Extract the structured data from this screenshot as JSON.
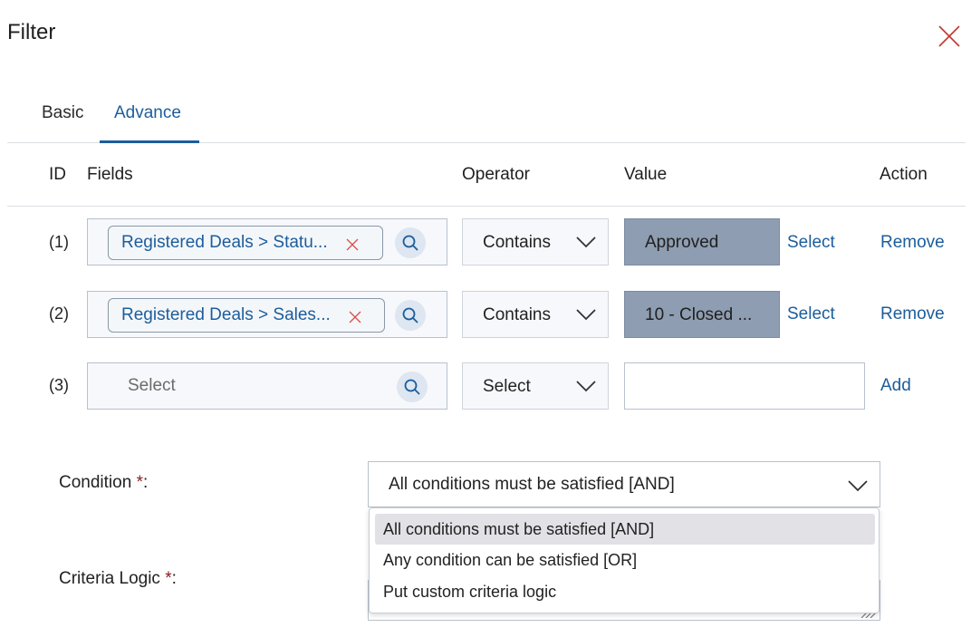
{
  "dialog": {
    "title": "Filter",
    "close_icon": "close-icon"
  },
  "tabs": [
    {
      "label": "Basic",
      "active": false
    },
    {
      "label": "Advance",
      "active": true
    }
  ],
  "columns": {
    "id": "ID",
    "fields": "Fields",
    "operator": "Operator",
    "value": "Value",
    "action": "Action"
  },
  "rows": [
    {
      "id": "(1)",
      "field": "Registered Deals > Statu...",
      "operator": "Contains",
      "value": "Approved",
      "select_label": "Select",
      "action": "Remove"
    },
    {
      "id": "(2)",
      "field": "Registered Deals > Sales...",
      "operator": "Contains",
      "value": "10 - Closed ...",
      "select_label": "Select",
      "action": "Remove"
    },
    {
      "id": "(3)",
      "field_placeholder": "Select",
      "operator": "Select",
      "value": "",
      "action": "Add"
    }
  ],
  "condition": {
    "label": "Condition",
    "required_mark": "*",
    "colon": ":",
    "selected": "All conditions must be satisfied [AND]",
    "options": [
      "All conditions must be satisfied [AND]",
      "Any condition can be satisfied [OR]",
      "Put custom criteria logic"
    ],
    "highlighted_index": 0
  },
  "criteria_logic": {
    "label": "Criteria Logic",
    "required_mark": "*",
    "colon": ":"
  },
  "colors": {
    "accent": "#1c5d9c",
    "close": "#c0392b",
    "value_fill": "#8e9db1",
    "required": "#8b1a1a"
  }
}
